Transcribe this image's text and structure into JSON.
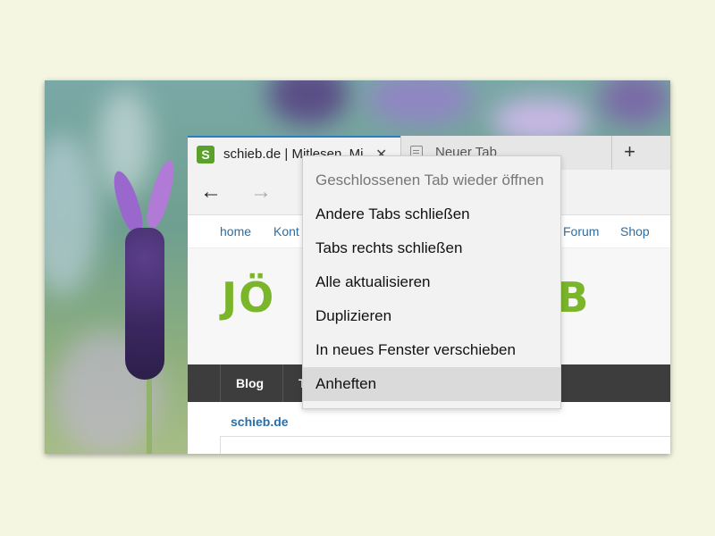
{
  "browser": {
    "tabs": [
      {
        "title": "schieb.de | Mitlesen, Mi",
        "favicon": "S",
        "active": true
      },
      {
        "title": "Neuer Tab",
        "active": false
      }
    ],
    "new_tab_label": "+",
    "close_glyph": "✕",
    "back_glyph": "←",
    "forward_glyph": "→"
  },
  "site": {
    "nav": {
      "home": "home",
      "kontakt": "Kont",
      "forum": "Forum",
      "shop": "Shop"
    },
    "logo_left": "JÖ",
    "logo_right": "EB",
    "main_nav": {
      "blog": "Blog",
      "second": "T"
    },
    "breadcrumb": "schieb.de",
    "accent": "#7bb52a",
    "link_color": "#2a6ea8"
  },
  "context_menu": {
    "items": [
      {
        "label": "Geschlossenen Tab wieder öffnen",
        "disabled": true
      },
      {
        "label": "Andere Tabs schließen"
      },
      {
        "label": "Tabs rechts schließen"
      },
      {
        "label": "Alle aktualisieren"
      },
      {
        "label": "Duplizieren"
      },
      {
        "label": "In neues Fenster verschieben"
      },
      {
        "label": "Anheften",
        "highlighted": true
      }
    ]
  }
}
